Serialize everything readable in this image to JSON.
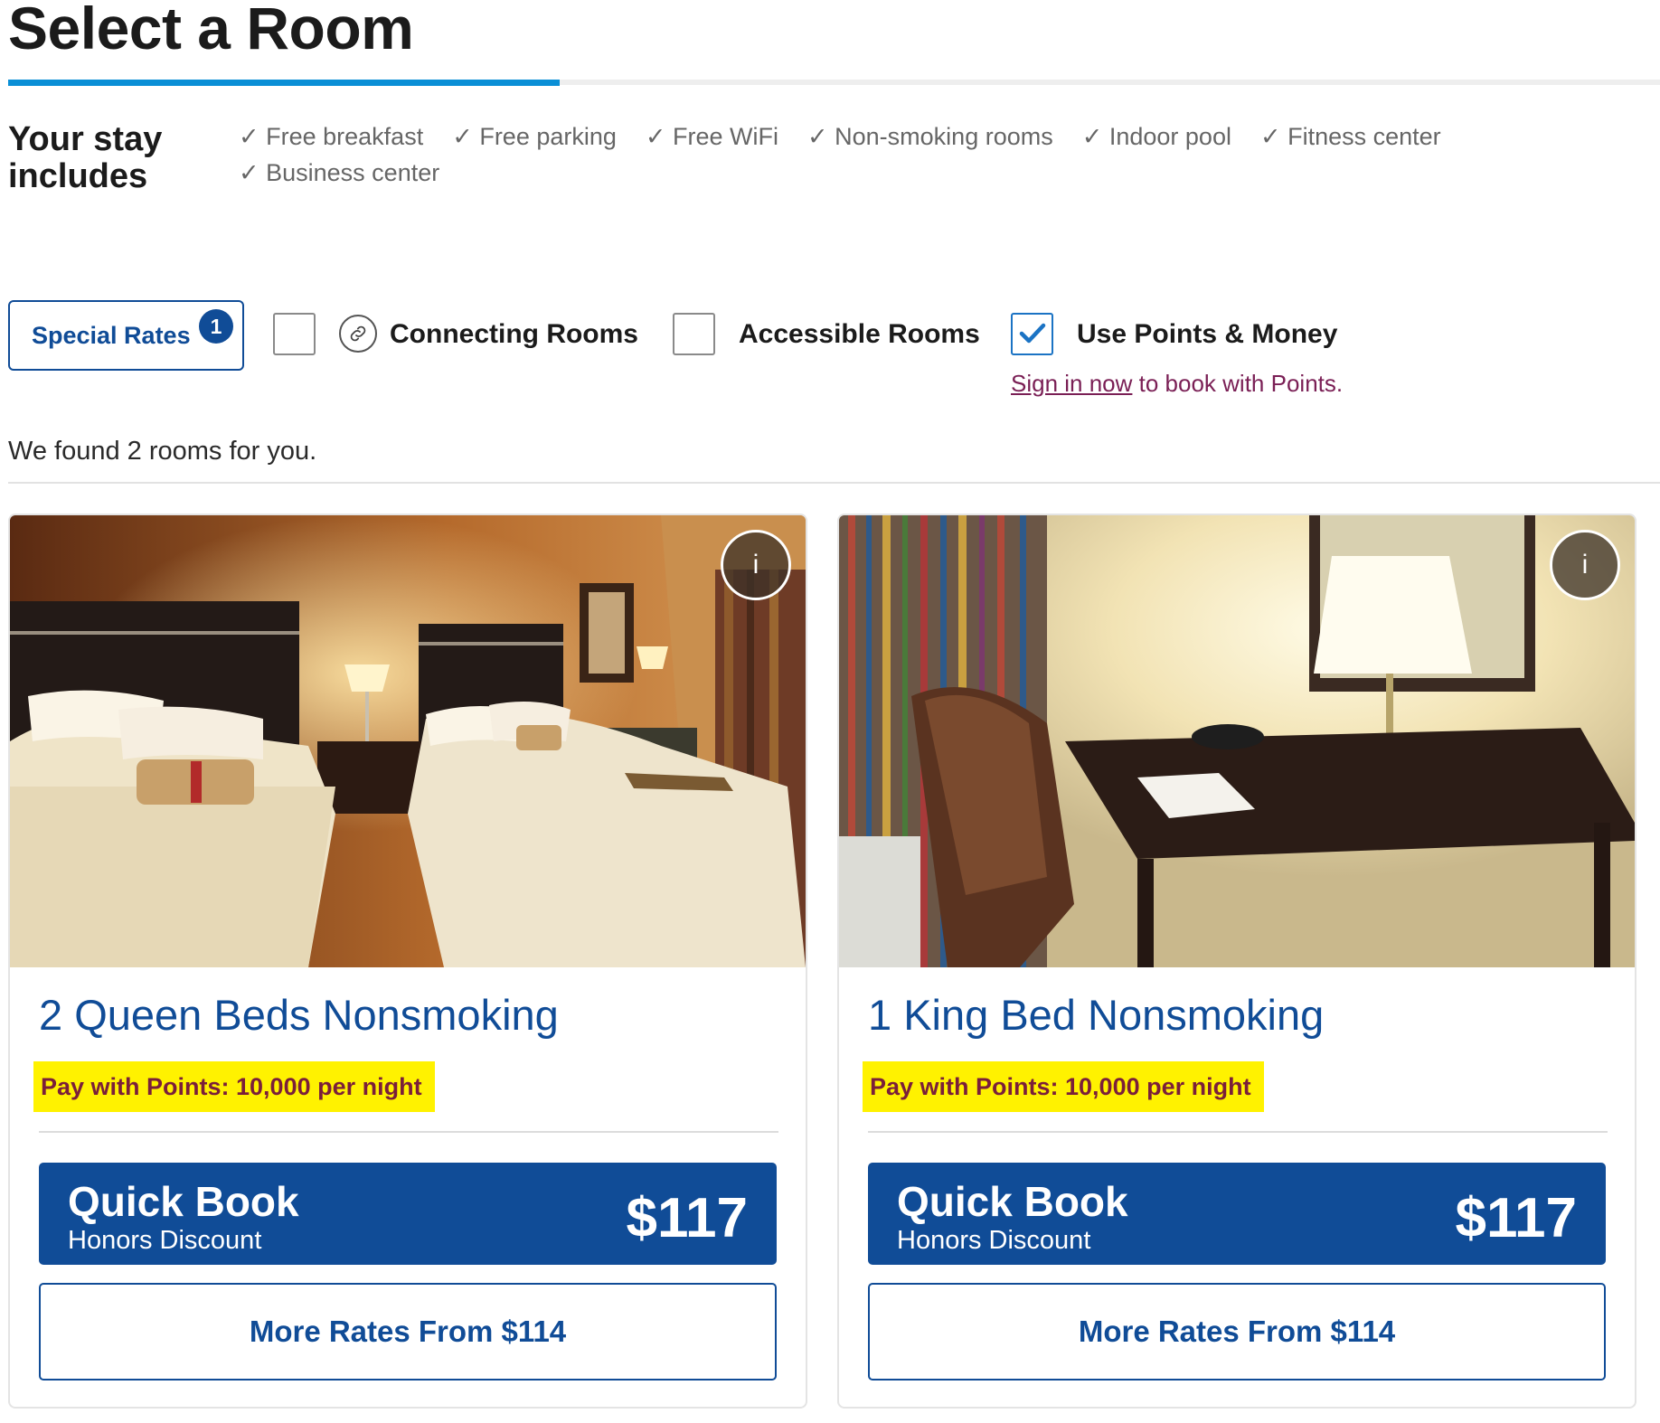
{
  "page": {
    "title": "Select a Room"
  },
  "stay": {
    "heading": "Your stay includes",
    "amenities": [
      "Free breakfast",
      "Free parking",
      "Free WiFi",
      "Non-smoking rooms",
      "Indoor pool",
      "Fitness center",
      "Business center"
    ]
  },
  "filters": {
    "special_rates_label": "Special Rates",
    "special_rates_count": "1",
    "connecting_label": "Connecting Rooms",
    "connecting_checked": false,
    "accessible_label": "Accessible Rooms",
    "accessible_checked": false,
    "points_label": "Use Points & Money",
    "points_checked": true,
    "signin_link": "Sign in now",
    "signin_rest": " to book with Points."
  },
  "results": {
    "summary": "We found 2 rooms for you."
  },
  "rooms": [
    {
      "name": "2 Queen Beds Nonsmoking",
      "points": "Pay with Points: 10,000 per night",
      "quickbook_title": "Quick Book",
      "quickbook_sub": "Honors Discount",
      "price": "$117",
      "more_rates": "More Rates From $114",
      "info": "i"
    },
    {
      "name": "1 King Bed Nonsmoking",
      "points": "Pay with Points: 10,000 per night",
      "quickbook_title": "Quick Book",
      "quickbook_sub": "Honors Discount",
      "price": "$117",
      "more_rates": "More Rates From $114",
      "info": "i"
    }
  ],
  "colors": {
    "brand_blue": "#104c97",
    "accent_blue": "#0a8fd6",
    "highlight": "#fff200",
    "link": "#7a1f55"
  }
}
